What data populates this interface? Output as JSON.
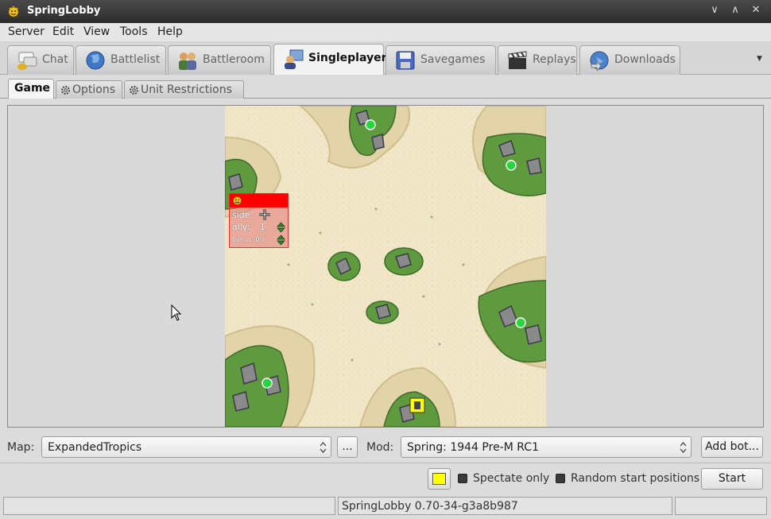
{
  "window": {
    "title": "SpringLobby",
    "controls": [
      "∨",
      "∧",
      "✕"
    ]
  },
  "menu": [
    "Server",
    "Edit",
    "View",
    "Tools",
    "Help"
  ],
  "tabs": [
    {
      "label": "Chat",
      "icon": "chat-icon"
    },
    {
      "label": "Battlelist",
      "icon": "globe-icon"
    },
    {
      "label": "Battleroom",
      "icon": "people-icon"
    },
    {
      "label": "Singleplayer",
      "icon": "singleplayer-icon",
      "active": true
    },
    {
      "label": "Savegames",
      "icon": "floppy-icon"
    },
    {
      "label": "Replays",
      "icon": "clapper-icon"
    },
    {
      "label": "Downloads",
      "icon": "download-globe-icon"
    }
  ],
  "subtabs": [
    {
      "label": "Game",
      "active": true
    },
    {
      "label": "Options"
    },
    {
      "label": "Unit Restrictions"
    }
  ],
  "team_box": {
    "side_label": "side:",
    "ally_label": "ally:",
    "ally_value": "1",
    "bonus_label": "bonus: 0%",
    "header_color": "#ff0000"
  },
  "controls": {
    "map_label": "Map:",
    "map_value": "ExpandedTropics",
    "ellipsis": "...",
    "mod_label": "Mod:",
    "mod_value": "Spring: 1944 Pre-M RC1",
    "add_bot": "Add bot...",
    "player_color": "#ffff00",
    "spectate_label": "Spectate only",
    "random_label": "Random start positions",
    "start": "Start"
  },
  "status": {
    "version": "SpringLobby 0.70-34-g3a8b987"
  }
}
